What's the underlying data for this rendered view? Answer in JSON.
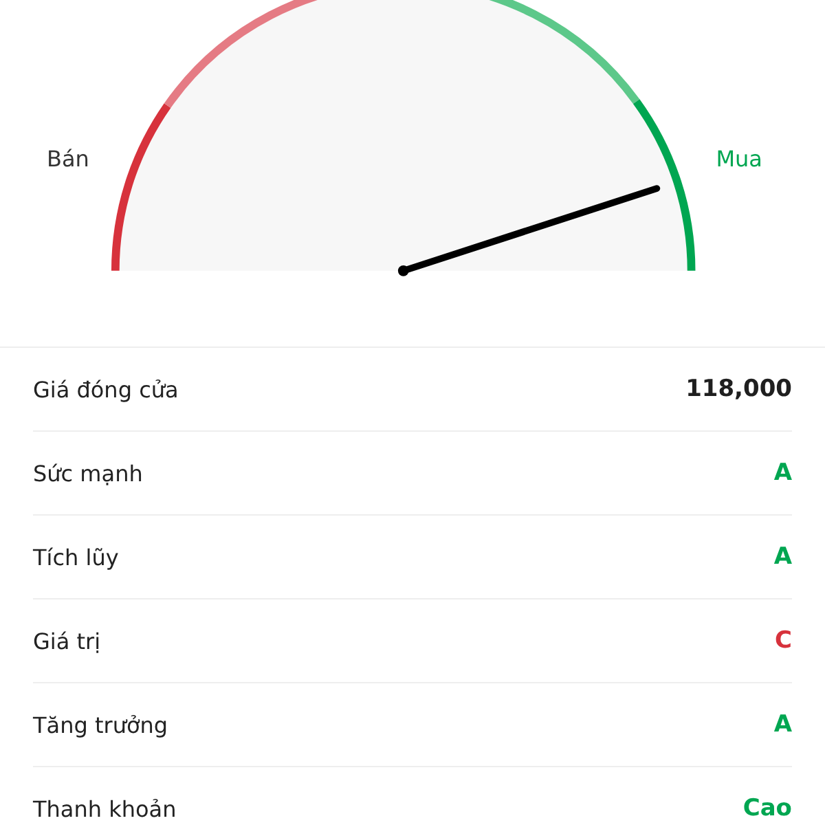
{
  "gauge": {
    "left_label": "Bán",
    "right_label": "Mua",
    "level": 0.9
  },
  "rows": [
    {
      "label": "Giá đóng cửa",
      "value": "118,000",
      "color": "#1f1f1f"
    },
    {
      "label": "Sức mạnh",
      "value": "A",
      "color": "#00a651"
    },
    {
      "label": "Tích lũy",
      "value": "A",
      "color": "#00a651"
    },
    {
      "label": "Giá trị",
      "value": "C",
      "color": "#d7323c"
    },
    {
      "label": "Tăng trưởng",
      "value": "A",
      "color": "#00a651"
    },
    {
      "label": "Thanh khoản",
      "value": "Cao",
      "color": "#00a651"
    }
  ]
}
